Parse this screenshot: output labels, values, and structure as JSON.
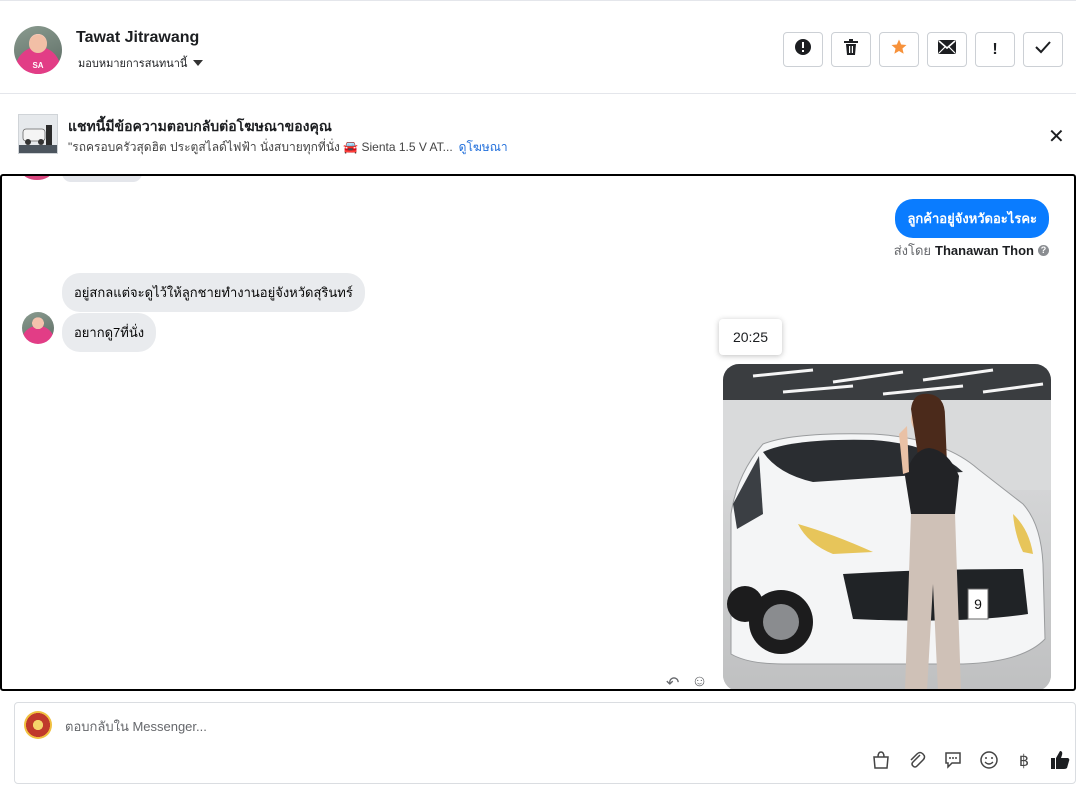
{
  "header": {
    "contact_name": "Tawat Jitrawang",
    "assign_label": "มอบหมายการสนทนานี้",
    "buttons": [
      {
        "icon": "alert-circle-icon",
        "glyph": "!"
      },
      {
        "icon": "trash-icon",
        "glyph": "🗑"
      },
      {
        "icon": "star-icon",
        "glyph": "★"
      },
      {
        "icon": "envelope-icon",
        "glyph": "✉"
      },
      {
        "icon": "exclamation-icon",
        "glyph": "!"
      },
      {
        "icon": "check-icon",
        "glyph": "✓"
      }
    ]
  },
  "ad_banner": {
    "title": "แชทนี้มีข้อความตอบกลับต่อโฆษณาของคุณ",
    "description": "\"รถครอบครัวสุดฮิต ประตูสไลด์ไฟฟ้า นั่งสบายทุกที่นั่ง 🚘 Sienta 1.5 V AT...",
    "link_label": "ดูโฆษณา",
    "close_glyph": "✕"
  },
  "messages": {
    "outgoing_text": "ลูกค้าอยู่จังหวัดอะไรคะ",
    "sent_by_prefix": "ส่งโดย",
    "sent_by_name": "Thanawan Thon",
    "incoming_1": "อยู่สกลแต่จะดูไว้ให้ลูกชายทำงานอยู่จังหวัดสุรินทร์",
    "incoming_2": "อยากดู7ที่นั่ง",
    "timestamp_tooltip": "20:25",
    "photo_plate_fragment": "9"
  },
  "composer": {
    "placeholder": "ตอบกลับใน Messenger...",
    "tools": [
      "shopping-bag-icon",
      "paperclip-icon",
      "chat-bubble-icon",
      "emoji-icon",
      "baht-icon",
      "thumbs-up-icon"
    ]
  },
  "colors": {
    "accent": "#0a7cff",
    "star": "#f7923b",
    "link": "#216fdb"
  }
}
